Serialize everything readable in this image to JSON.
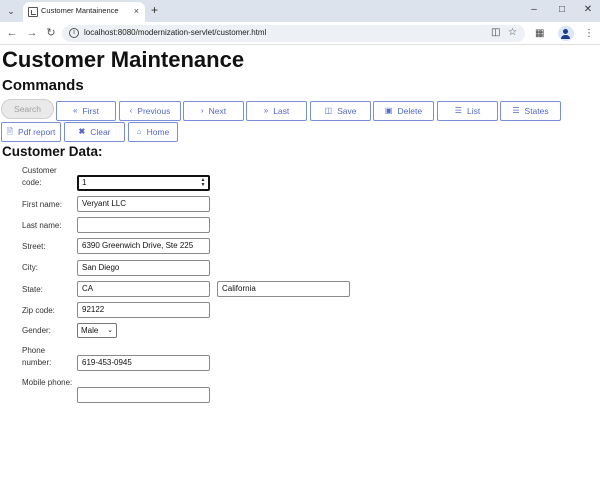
{
  "browser": {
    "tab_title": "Customer Mantainence",
    "url": "localhost:8080/modernization-servlet/customer.html",
    "new_tab": "+",
    "close_tab": "×",
    "minimize": "–",
    "maximize": "□",
    "close_window": "✕"
  },
  "page": {
    "title": "Customer Maintenance",
    "commands_heading": "Commands",
    "data_heading": "Customer Data:"
  },
  "commands": {
    "search": "Search",
    "first": "First",
    "previous": "Previous",
    "next": "Next",
    "last": "Last",
    "save": "Save",
    "delete": "Delete",
    "list": "List",
    "states": "States",
    "pdf_report": "Pdf report",
    "clear": "Clear",
    "home": "Home"
  },
  "form": {
    "customer_code": {
      "label": "Customer code:",
      "value": "1"
    },
    "first_name": {
      "label": "First name:",
      "value": "Veryant LLC"
    },
    "last_name": {
      "label": "Last name:",
      "value": ""
    },
    "street": {
      "label": "Street:",
      "value": "6390 Greenwich Drive, Ste 225"
    },
    "city": {
      "label": "City:",
      "value": "San Diego"
    },
    "state": {
      "label": "State:",
      "value": "CA",
      "state_name": "California"
    },
    "zip": {
      "label": "Zip code:",
      "value": "92122"
    },
    "gender": {
      "label": "Gender:",
      "value": "Male"
    },
    "phone": {
      "label": "Phone number:",
      "value": "619-453-0945"
    },
    "mobile": {
      "label": "Mobile phone:",
      "value": ""
    }
  },
  "colors": {
    "button_border": "#7b8fd8",
    "button_text": "#5568c4"
  }
}
